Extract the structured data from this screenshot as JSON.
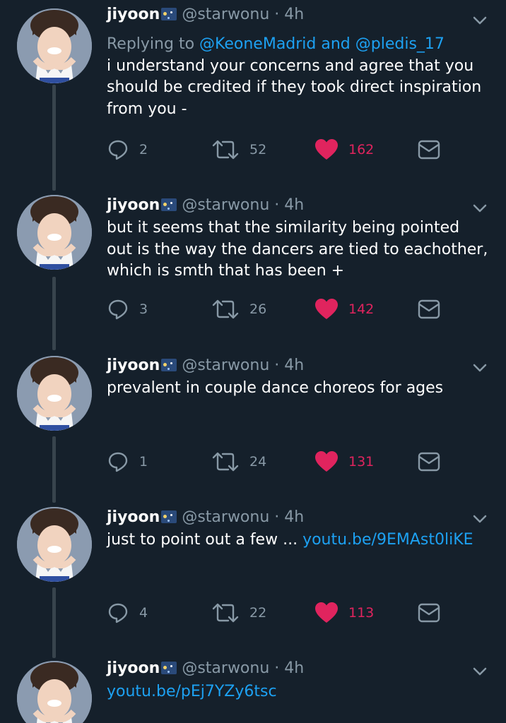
{
  "tweets": [
    {
      "name": "jiyoon",
      "handle": "@starwonu",
      "separator": "·",
      "time": "4h",
      "reply_prefix": "Replying to ",
      "reply_mentions": "@KeoneMadrid and @pledis_17",
      "text": "i understand your concerns and agree that you should be credited if they took direct inspiration from you -",
      "link": "",
      "replies": "2",
      "retweets": "52",
      "likes": "162"
    },
    {
      "name": "jiyoon",
      "handle": "@starwonu",
      "separator": "·",
      "time": "4h",
      "text": "but it seems that the similarity being pointed out is the way the dancers are tied to eachother, which is smth that has been +",
      "link": "",
      "replies": "3",
      "retweets": "26",
      "likes": "142"
    },
    {
      "name": "jiyoon",
      "handle": "@starwonu",
      "separator": "·",
      "time": "4h",
      "text": "prevalent in couple dance choreos for ages",
      "link": "",
      "replies": "1",
      "retweets": "24",
      "likes": "131"
    },
    {
      "name": "jiyoon",
      "handle": "@starwonu",
      "separator": "·",
      "time": "4h",
      "text": "just to point out a few ... ",
      "link": "youtu.be/9EMAst0liKE",
      "replies": "4",
      "retweets": "22",
      "likes": "113"
    },
    {
      "name": "jiyoon",
      "handle": "@starwonu",
      "separator": "·",
      "time": "4h",
      "text": "",
      "link": "youtu.be/pEj7YZy6tsc"
    }
  ],
  "colors": {
    "background": "#15202b",
    "secondary_text": "#8899a6",
    "link": "#1da1f2",
    "like": "#e0245e",
    "thread_line": "#38444d"
  },
  "icons": {
    "reply": "reply-icon",
    "retweet": "retweet-icon",
    "like": "heart-icon",
    "dm": "envelope-icon",
    "menu": "chevron-down-icon"
  }
}
